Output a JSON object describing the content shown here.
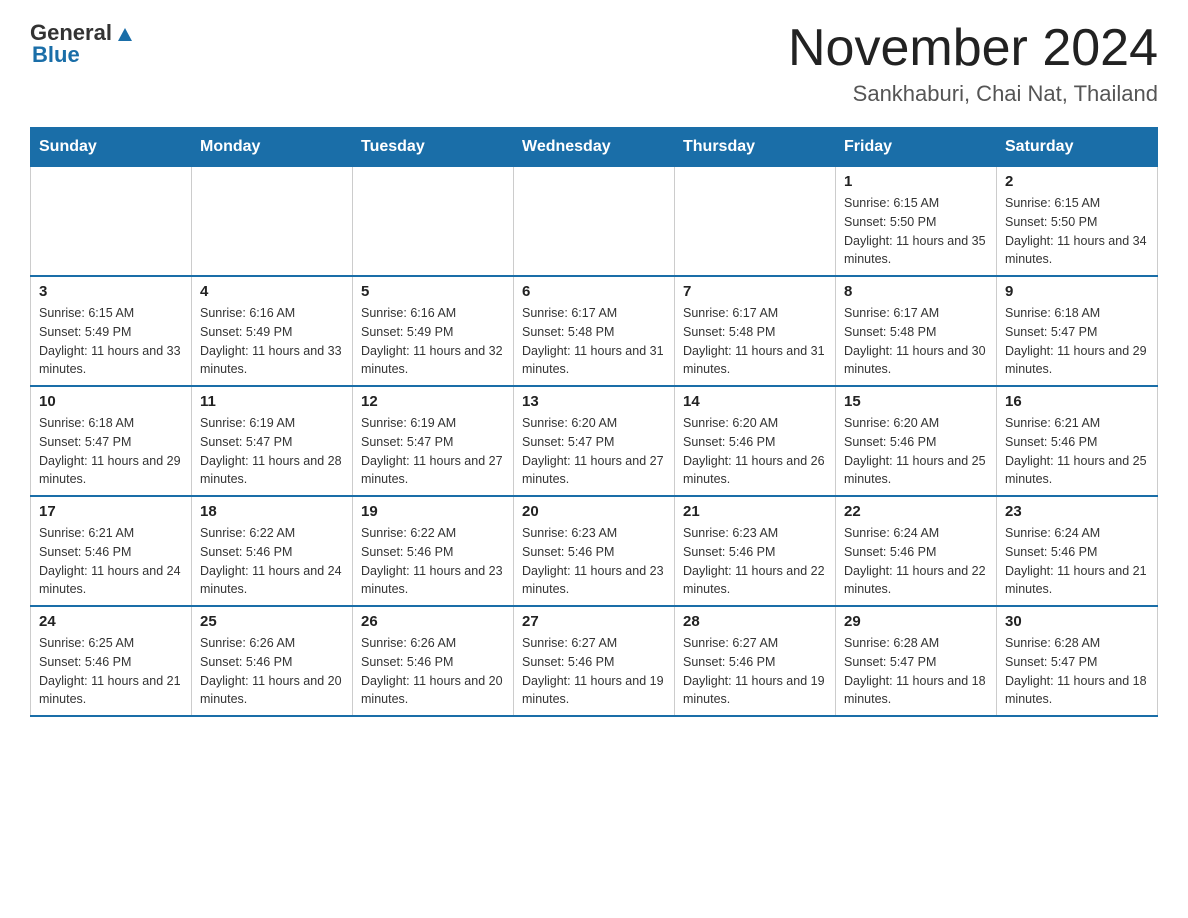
{
  "header": {
    "logo_general": "General",
    "logo_blue": "Blue",
    "month_title": "November 2024",
    "location": "Sankhaburi, Chai Nat, Thailand"
  },
  "days_of_week": [
    "Sunday",
    "Monday",
    "Tuesday",
    "Wednesday",
    "Thursday",
    "Friday",
    "Saturday"
  ],
  "weeks": [
    {
      "days": [
        {
          "date": "",
          "info": ""
        },
        {
          "date": "",
          "info": ""
        },
        {
          "date": "",
          "info": ""
        },
        {
          "date": "",
          "info": ""
        },
        {
          "date": "",
          "info": ""
        },
        {
          "date": "1",
          "info": "Sunrise: 6:15 AM\nSunset: 5:50 PM\nDaylight: 11 hours and 35 minutes."
        },
        {
          "date": "2",
          "info": "Sunrise: 6:15 AM\nSunset: 5:50 PM\nDaylight: 11 hours and 34 minutes."
        }
      ]
    },
    {
      "days": [
        {
          "date": "3",
          "info": "Sunrise: 6:15 AM\nSunset: 5:49 PM\nDaylight: 11 hours and 33 minutes."
        },
        {
          "date": "4",
          "info": "Sunrise: 6:16 AM\nSunset: 5:49 PM\nDaylight: 11 hours and 33 minutes."
        },
        {
          "date": "5",
          "info": "Sunrise: 6:16 AM\nSunset: 5:49 PM\nDaylight: 11 hours and 32 minutes."
        },
        {
          "date": "6",
          "info": "Sunrise: 6:17 AM\nSunset: 5:48 PM\nDaylight: 11 hours and 31 minutes."
        },
        {
          "date": "7",
          "info": "Sunrise: 6:17 AM\nSunset: 5:48 PM\nDaylight: 11 hours and 31 minutes."
        },
        {
          "date": "8",
          "info": "Sunrise: 6:17 AM\nSunset: 5:48 PM\nDaylight: 11 hours and 30 minutes."
        },
        {
          "date": "9",
          "info": "Sunrise: 6:18 AM\nSunset: 5:47 PM\nDaylight: 11 hours and 29 minutes."
        }
      ]
    },
    {
      "days": [
        {
          "date": "10",
          "info": "Sunrise: 6:18 AM\nSunset: 5:47 PM\nDaylight: 11 hours and 29 minutes."
        },
        {
          "date": "11",
          "info": "Sunrise: 6:19 AM\nSunset: 5:47 PM\nDaylight: 11 hours and 28 minutes."
        },
        {
          "date": "12",
          "info": "Sunrise: 6:19 AM\nSunset: 5:47 PM\nDaylight: 11 hours and 27 minutes."
        },
        {
          "date": "13",
          "info": "Sunrise: 6:20 AM\nSunset: 5:47 PM\nDaylight: 11 hours and 27 minutes."
        },
        {
          "date": "14",
          "info": "Sunrise: 6:20 AM\nSunset: 5:46 PM\nDaylight: 11 hours and 26 minutes."
        },
        {
          "date": "15",
          "info": "Sunrise: 6:20 AM\nSunset: 5:46 PM\nDaylight: 11 hours and 25 minutes."
        },
        {
          "date": "16",
          "info": "Sunrise: 6:21 AM\nSunset: 5:46 PM\nDaylight: 11 hours and 25 minutes."
        }
      ]
    },
    {
      "days": [
        {
          "date": "17",
          "info": "Sunrise: 6:21 AM\nSunset: 5:46 PM\nDaylight: 11 hours and 24 minutes."
        },
        {
          "date": "18",
          "info": "Sunrise: 6:22 AM\nSunset: 5:46 PM\nDaylight: 11 hours and 24 minutes."
        },
        {
          "date": "19",
          "info": "Sunrise: 6:22 AM\nSunset: 5:46 PM\nDaylight: 11 hours and 23 minutes."
        },
        {
          "date": "20",
          "info": "Sunrise: 6:23 AM\nSunset: 5:46 PM\nDaylight: 11 hours and 23 minutes."
        },
        {
          "date": "21",
          "info": "Sunrise: 6:23 AM\nSunset: 5:46 PM\nDaylight: 11 hours and 22 minutes."
        },
        {
          "date": "22",
          "info": "Sunrise: 6:24 AM\nSunset: 5:46 PM\nDaylight: 11 hours and 22 minutes."
        },
        {
          "date": "23",
          "info": "Sunrise: 6:24 AM\nSunset: 5:46 PM\nDaylight: 11 hours and 21 minutes."
        }
      ]
    },
    {
      "days": [
        {
          "date": "24",
          "info": "Sunrise: 6:25 AM\nSunset: 5:46 PM\nDaylight: 11 hours and 21 minutes."
        },
        {
          "date": "25",
          "info": "Sunrise: 6:26 AM\nSunset: 5:46 PM\nDaylight: 11 hours and 20 minutes."
        },
        {
          "date": "26",
          "info": "Sunrise: 6:26 AM\nSunset: 5:46 PM\nDaylight: 11 hours and 20 minutes."
        },
        {
          "date": "27",
          "info": "Sunrise: 6:27 AM\nSunset: 5:46 PM\nDaylight: 11 hours and 19 minutes."
        },
        {
          "date": "28",
          "info": "Sunrise: 6:27 AM\nSunset: 5:46 PM\nDaylight: 11 hours and 19 minutes."
        },
        {
          "date": "29",
          "info": "Sunrise: 6:28 AM\nSunset: 5:47 PM\nDaylight: 11 hours and 18 minutes."
        },
        {
          "date": "30",
          "info": "Sunrise: 6:28 AM\nSunset: 5:47 PM\nDaylight: 11 hours and 18 minutes."
        }
      ]
    }
  ]
}
